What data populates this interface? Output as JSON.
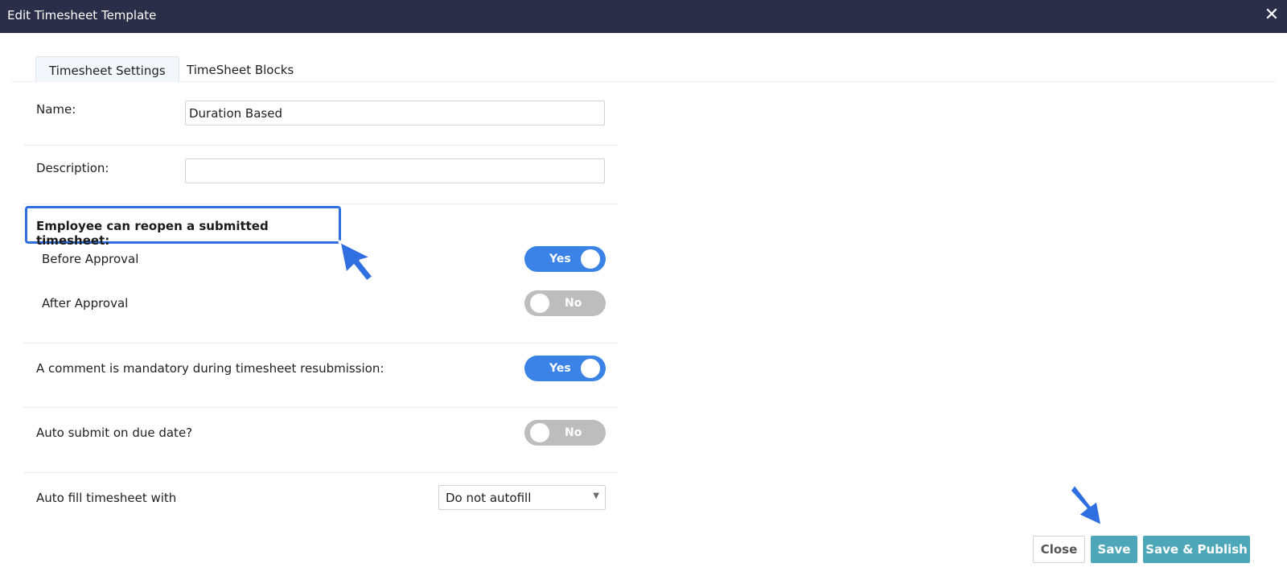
{
  "window": {
    "title": "Edit Timesheet Template",
    "close_glyph": "✕"
  },
  "tabs": [
    {
      "label": "Timesheet Settings",
      "active": true
    },
    {
      "label": "TimeSheet Blocks",
      "active": false
    }
  ],
  "form": {
    "name": {
      "label": "Name:",
      "value": "Duration Based"
    },
    "description": {
      "label": "Description:",
      "value": ""
    },
    "reopen": {
      "heading": "Employee can reopen a submitted timesheet:",
      "before_approval": {
        "label": "Before Approval",
        "toggle": "Yes",
        "on": true
      },
      "after_approval": {
        "label": "After Approval",
        "toggle": "No",
        "on": false
      }
    },
    "comment_mandatory": {
      "label": "A comment is mandatory during timesheet resubmission:",
      "toggle": "Yes",
      "on": true
    },
    "auto_submit": {
      "label": "Auto submit on due date?",
      "toggle": "No",
      "on": false
    },
    "auto_fill": {
      "label": "Auto fill timesheet with",
      "selected": "Do not autofill"
    }
  },
  "buttons": {
    "close": "Close",
    "save": "Save",
    "save_publish": "Save & Publish"
  },
  "colors": {
    "titlebar": "#2b2e48",
    "toggle_on": "#3b82e6",
    "toggle_off": "#bdbdbd",
    "button_primary": "#4ea7b8",
    "highlight": "#2f6fe0"
  },
  "icons": {
    "close": "close-icon",
    "pointer_arrow": "pointer-arrow-icon",
    "select_caret": "chevron-down-icon"
  }
}
